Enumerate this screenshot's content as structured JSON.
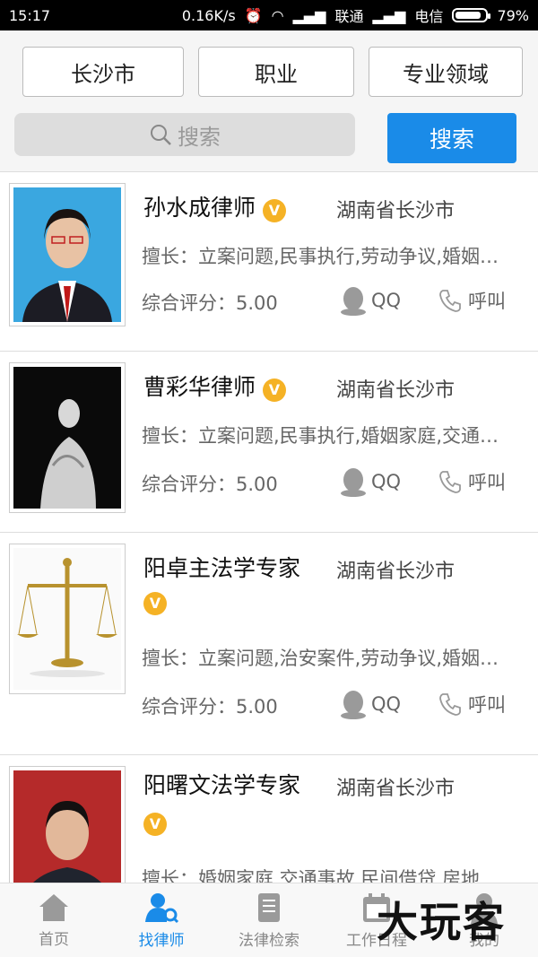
{
  "status_bar": {
    "time": "15:17",
    "speed": "0.16K/s",
    "carrier1": "联通",
    "carrier2": "电信",
    "battery": "79%"
  },
  "filters": {
    "city": "长沙市",
    "profession": "职业",
    "field": "专业领域"
  },
  "search": {
    "placeholder": "搜索",
    "button": "搜索"
  },
  "lawyers": [
    {
      "name": "孙水成律师",
      "location": "湖南省长沙市",
      "specialty": "擅长：立案问题,民事执行,劳动争议,婚姻…",
      "rating": "综合评分：5.00",
      "qq": "QQ",
      "call": "呼叫",
      "badge": "V"
    },
    {
      "name": "曹彩华律师",
      "location": "湖南省长沙市",
      "specialty": "擅长：立案问题,民事执行,婚姻家庭,交通…",
      "rating": "综合评分：5.00",
      "qq": "QQ",
      "call": "呼叫",
      "badge": "V"
    },
    {
      "name": "阳卓主法学专家",
      "location": "湖南省长沙市",
      "specialty": "擅长：立案问题,治安案件,劳动争议,婚姻…",
      "rating": "综合评分：5.00",
      "qq": "QQ",
      "call": "呼叫",
      "badge": "V"
    },
    {
      "name": "阳曙文法学专家",
      "location": "湖南省长沙市",
      "specialty": "擅长：婚姻家庭,交通事故,民间借贷,房地…",
      "badge": "V"
    }
  ],
  "tabs": [
    {
      "label": "首页",
      "icon": "home-icon"
    },
    {
      "label": "找律师",
      "icon": "find-lawyer-icon",
      "active": true
    },
    {
      "label": "法律检索",
      "icon": "law-search-icon"
    },
    {
      "label": "工作日程",
      "icon": "calendar-icon"
    },
    {
      "label": "我的",
      "icon": "user-icon"
    }
  ],
  "watermark": "大玩客",
  "colors": {
    "accent": "#1a8be8",
    "badge": "#f5b225"
  }
}
